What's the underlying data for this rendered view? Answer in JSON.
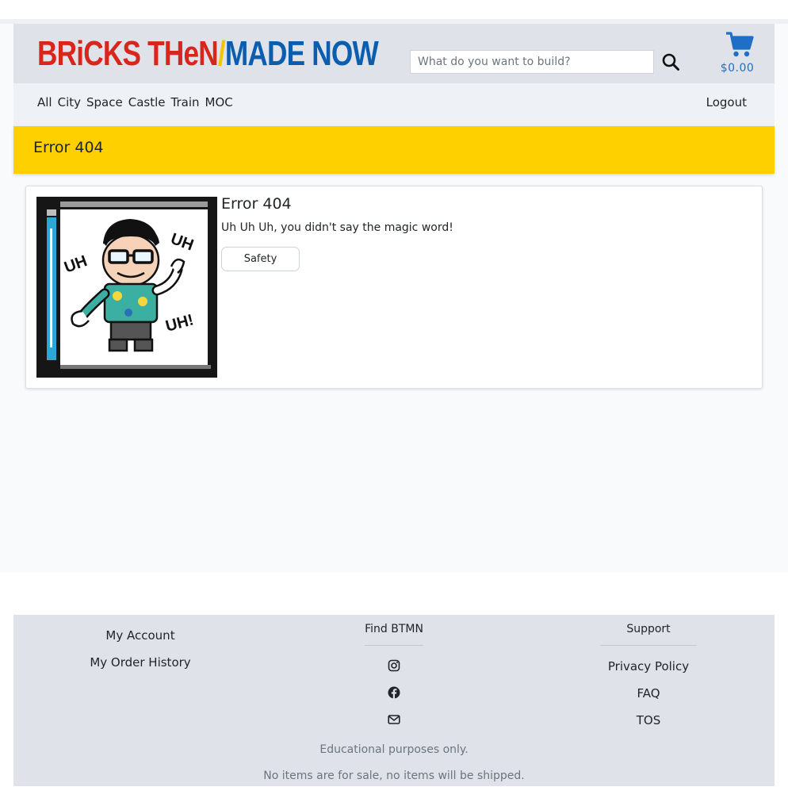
{
  "brand": {
    "part1": "BRiCKS THeN",
    "slash": "/",
    "part2": "MADE NOW"
  },
  "search": {
    "placeholder": "What do you want to build?",
    "value": ""
  },
  "cart": {
    "total": "$0.00"
  },
  "nav": {
    "links": [
      "All",
      "City",
      "Space",
      "Castle",
      "Train",
      "MOC"
    ],
    "logout": "Logout"
  },
  "banner": {
    "title": "Error 404"
  },
  "card": {
    "title": "Error 404",
    "text": "Uh Uh Uh, you didn't say the magic word!",
    "button": "Safety",
    "image_lettering": [
      "UH",
      "UH",
      "UH!"
    ]
  },
  "footer": {
    "account_links": [
      "My Account",
      "My Order History"
    ],
    "find_heading": "Find BTMN",
    "find_icons": [
      "instagram-icon",
      "facebook-icon",
      "envelope-icon"
    ],
    "support_heading": "Support",
    "support_links": [
      "Privacy Policy",
      "FAQ",
      "TOS"
    ],
    "note1": "Educational purposes only.",
    "note2": "No items are for sale, no items will be shipped."
  },
  "colors": {
    "brand_red": "#d9261c",
    "brand_yellow": "#f2c500",
    "brand_blue": "#0b5db0",
    "banner": "#fed000",
    "cart": "#1e6fc5"
  }
}
